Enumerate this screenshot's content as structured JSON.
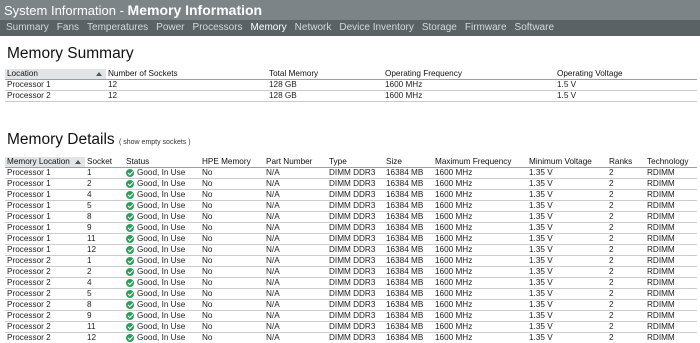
{
  "window": {
    "title_prefix": "System Information - ",
    "title_main": "Memory Information"
  },
  "nav": {
    "tabs": [
      "Summary",
      "Fans",
      "Temperatures",
      "Power",
      "Processors",
      "Memory",
      "Network",
      "Device Inventory",
      "Storage",
      "Firmware",
      "Software"
    ],
    "active": "Memory"
  },
  "summary": {
    "title": "Memory Summary",
    "columns": [
      "Location",
      "Number of Sockets",
      "Total Memory",
      "Operating Frequency",
      "Operating Voltage"
    ],
    "rows": [
      [
        "Processor 1",
        "12",
        "128 GB",
        "1600 MHz",
        "1.5 V"
      ],
      [
        "Processor 2",
        "12",
        "128 GB",
        "1600 MHz",
        "1.5 V"
      ]
    ]
  },
  "details": {
    "title": "Memory Details",
    "show_empty_link": "( show empty sockets )",
    "columns": [
      "Memory Location",
      "Socket",
      "Status",
      "HPE Memory",
      "Part Number",
      "Type",
      "Size",
      "Maximum Frequency",
      "Minimum Voltage",
      "Ranks",
      "Technology"
    ],
    "rows": [
      [
        "Processor 1",
        "1",
        "Good, In Use",
        "No",
        "N/A",
        "DIMM DDR3",
        "16384 MB",
        "1600 MHz",
        "1.35 V",
        "2",
        "RDIMM"
      ],
      [
        "Processor 1",
        "2",
        "Good, In Use",
        "No",
        "N/A",
        "DIMM DDR3",
        "16384 MB",
        "1600 MHz",
        "1.35 V",
        "2",
        "RDIMM"
      ],
      [
        "Processor 1",
        "4",
        "Good, In Use",
        "No",
        "N/A",
        "DIMM DDR3",
        "16384 MB",
        "1600 MHz",
        "1.35 V",
        "2",
        "RDIMM"
      ],
      [
        "Processor 1",
        "5",
        "Good, In Use",
        "No",
        "N/A",
        "DIMM DDR3",
        "16384 MB",
        "1600 MHz",
        "1.35 V",
        "2",
        "RDIMM"
      ],
      [
        "Processor 1",
        "8",
        "Good, In Use",
        "No",
        "N/A",
        "DIMM DDR3",
        "16384 MB",
        "1600 MHz",
        "1.35 V",
        "2",
        "RDIMM"
      ],
      [
        "Processor 1",
        "9",
        "Good, In Use",
        "No",
        "N/A",
        "DIMM DDR3",
        "16384 MB",
        "1600 MHz",
        "1.35 V",
        "2",
        "RDIMM"
      ],
      [
        "Processor 1",
        "11",
        "Good, In Use",
        "No",
        "N/A",
        "DIMM DDR3",
        "16384 MB",
        "1600 MHz",
        "1.35 V",
        "2",
        "RDIMM"
      ],
      [
        "Processor 1",
        "12",
        "Good, In Use",
        "No",
        "N/A",
        "DIMM DDR3",
        "16384 MB",
        "1600 MHz",
        "1.35 V",
        "2",
        "RDIMM"
      ],
      [
        "Processor 2",
        "1",
        "Good, In Use",
        "No",
        "N/A",
        "DIMM DDR3",
        "16384 MB",
        "1600 MHz",
        "1.35 V",
        "2",
        "RDIMM"
      ],
      [
        "Processor 2",
        "2",
        "Good, In Use",
        "No",
        "N/A",
        "DIMM DDR3",
        "16384 MB",
        "1600 MHz",
        "1.35 V",
        "2",
        "RDIMM"
      ],
      [
        "Processor 2",
        "4",
        "Good, In Use",
        "No",
        "N/A",
        "DIMM DDR3",
        "16384 MB",
        "1600 MHz",
        "1.35 V",
        "2",
        "RDIMM"
      ],
      [
        "Processor 2",
        "5",
        "Good, In Use",
        "No",
        "N/A",
        "DIMM DDR3",
        "16384 MB",
        "1600 MHz",
        "1.35 V",
        "2",
        "RDIMM"
      ],
      [
        "Processor 2",
        "8",
        "Good, In Use",
        "No",
        "N/A",
        "DIMM DDR3",
        "16384 MB",
        "1600 MHz",
        "1.35 V",
        "2",
        "RDIMM"
      ],
      [
        "Processor 2",
        "9",
        "Good, In Use",
        "No",
        "N/A",
        "DIMM DDR3",
        "16384 MB",
        "1600 MHz",
        "1.35 V",
        "2",
        "RDIMM"
      ],
      [
        "Processor 2",
        "11",
        "Good, In Use",
        "No",
        "N/A",
        "DIMM DDR3",
        "16384 MB",
        "1600 MHz",
        "1.35 V",
        "2",
        "RDIMM"
      ],
      [
        "Processor 2",
        "12",
        "Good, In Use",
        "No",
        "N/A",
        "DIMM DDR3",
        "16384 MB",
        "1600 MHz",
        "1.35 V",
        "2",
        "RDIMM"
      ]
    ]
  },
  "icons": {
    "status_ok": "check-circle-icon",
    "sort": "sort-ascending-icon"
  },
  "colors": {
    "title_bar": "#7d8488",
    "nav_bar": "#5b6266",
    "status_ok": "#2e9e5a"
  }
}
